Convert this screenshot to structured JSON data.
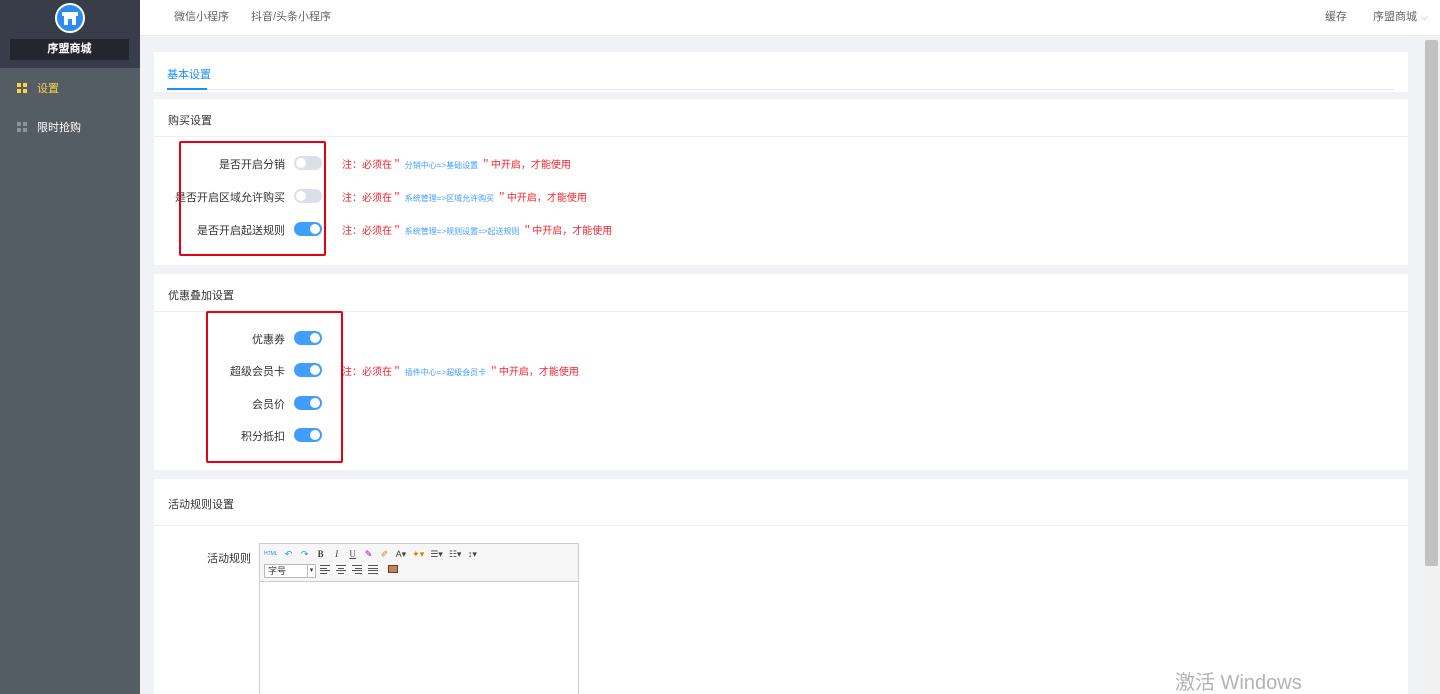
{
  "sidebar": {
    "brand": "序盟商城",
    "items": [
      {
        "label": "设置",
        "icon": "grid-icon",
        "active": true
      },
      {
        "label": "限时抢购",
        "icon": "grid-icon",
        "active": false
      }
    ]
  },
  "topbar": {
    "tabs": [
      "微信小程序",
      "抖音/头条小程序"
    ],
    "cache": "缓存",
    "user": "序盟商城"
  },
  "tabs": {
    "basic": "基本设置"
  },
  "purchase": {
    "title": "购买设置",
    "rows": [
      {
        "label": "是否开启分销",
        "on": false,
        "note_pre": "注：必须在＂",
        "note_path": "分销中心=>基础设置",
        "note_post": "＂中开启，才能使用"
      },
      {
        "label": "是否开启区域允许购买",
        "on": false,
        "note_pre": "注：必须在＂",
        "note_path": "系统管理=>区域允许购买",
        "note_post": "＂中开启，才能使用"
      },
      {
        "label": "是否开启起送规则",
        "on": true,
        "note_pre": "注：必须在＂",
        "note_path": "系统管理=>规则设置=>起送规则",
        "note_post": "＂中开启，才能使用"
      }
    ]
  },
  "discount": {
    "title": "优惠叠加设置",
    "rows": [
      {
        "label": "优惠券",
        "on": true
      },
      {
        "label": "超级会员卡",
        "on": true
      },
      {
        "label": "会员价",
        "on": true
      },
      {
        "label": "积分抵扣",
        "on": true
      }
    ],
    "note_pre": "注：必须在＂",
    "note_path": "插件中心=>超级会员卡",
    "note_post": "＂中开启，才能使用"
  },
  "rules": {
    "title": "活动规则设置",
    "label": "活动规则",
    "font_select": "字号"
  },
  "editor_toolbar": {
    "html": "HTML",
    "bold": "B",
    "italic": "I",
    "underline": "U",
    "fontcolor": "A",
    "list_caret": "▾"
  },
  "watermark": "激活 Windows",
  "colors": {
    "accent": "#409eff",
    "warning": "#f5222d",
    "sidebar": "#545c64",
    "active_menu": "#ffd04b"
  }
}
